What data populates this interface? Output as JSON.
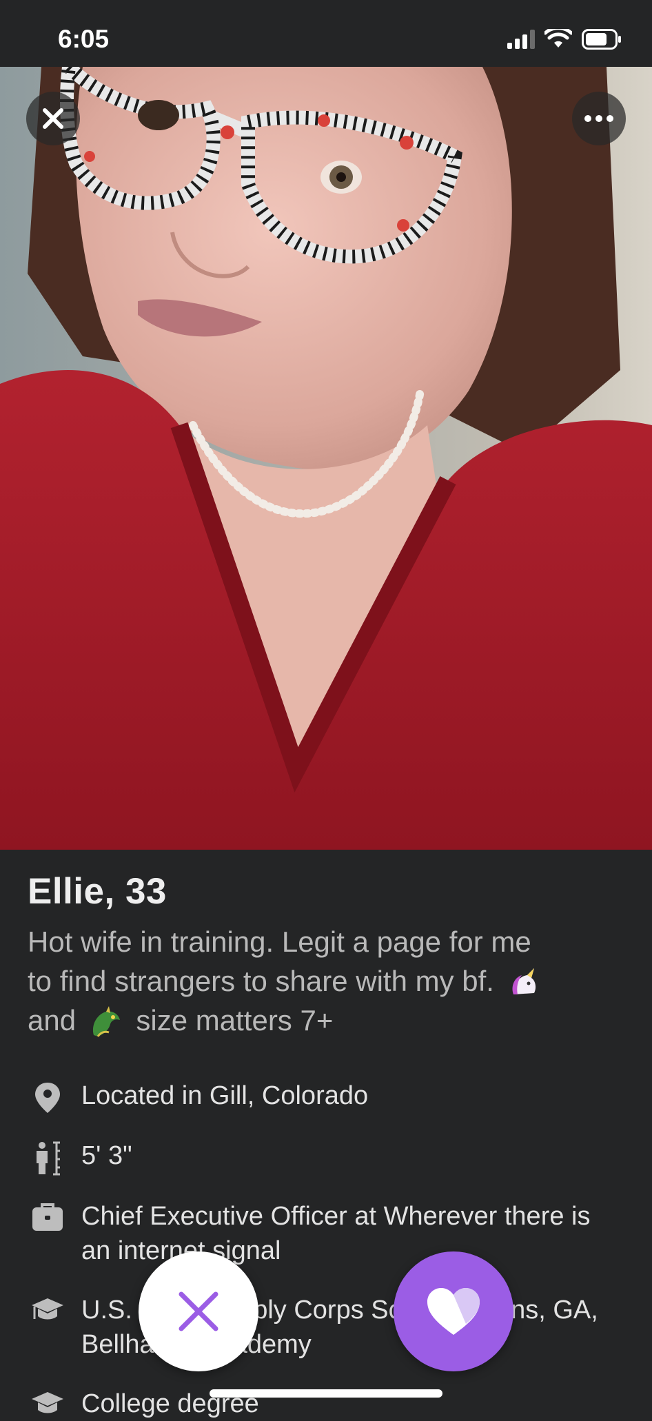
{
  "status_bar": {
    "time": "6:05",
    "icons": [
      "cellular-signal-icon",
      "wifi-icon",
      "battery-icon"
    ]
  },
  "photo": {
    "alt": "profile photo",
    "close_icon": "close-icon",
    "more_icon": "more-dots-icon"
  },
  "profile": {
    "name_age": "Ellie, 33",
    "bio_line1": "Hot wife in training. Legit a page for me",
    "bio_line2": "to find strangers to share with my bf.",
    "bio_line3_start": "and",
    "bio_line3_end": "size matters 7+",
    "bio_emoji_1": "unicorn-emoji",
    "bio_emoji_2": "dragon-emoji"
  },
  "details": [
    {
      "icon": "location-pin-icon",
      "text": "Located in Gill, Colorado"
    },
    {
      "icon": "height-icon",
      "text": "5' 3\""
    },
    {
      "icon": "briefcase-icon",
      "text": "Chief Executive Officer at Wherever there is an internet signal"
    },
    {
      "icon": "graduation-cap-icon",
      "text": "U.S. Navy Supply Corps School Athens, GA, Bellhaven Academy"
    },
    {
      "icon": "graduation-cap-icon",
      "text": "College degree"
    }
  ],
  "actions": {
    "pass_icon": "x-icon",
    "like_icon": "heart-icon"
  },
  "colors": {
    "background": "#242526",
    "accent": "#9b5de5",
    "text_primary": "#eeeeee",
    "text_secondary": "#b9b9b9"
  }
}
